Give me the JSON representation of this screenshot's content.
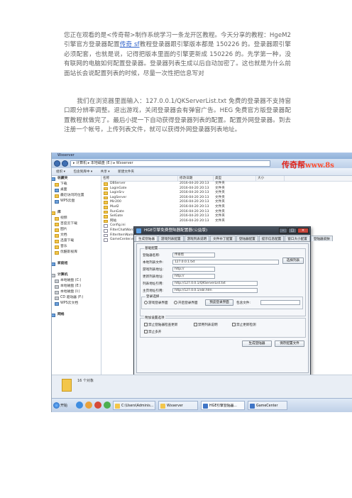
{
  "article": {
    "p1_a": "您正在观看的是<传奇帮>制作系统学习一条龙开区教程。今天分享的教程：HgeM2 引擎官方登录器配置",
    "p1_link": "传奇 sf",
    "p1_b": "教程登录器跟引擎版本都是 150226 的。登录器跟引擎必须配套，也就是说，记得把版本里面的引擎更新成 150226 的。先学第一种，没有联网的电脑如何配置登录器。登录器列表生成以后自动加密了。这也就是为什么前面站长会说配置列表的时候，尽量一次性把信息写对",
    "p2": "我们在浏览器里面输入：127.0.0.1/QKServerList.txt 免费的登录器不支持窗口跟分辨率调整。退出游戏，关闭登录器会有弹窗广告。HEG 免费官方版登录器配置教程就做完了。最后小提一下自动获得登录器列表的配置。配置外网登录器。到去注册一个帐号，上传列表文件，就可以获得外网登录器列表地址。"
  },
  "explorer": {
    "title": "Wxserver",
    "address": "▸ 计算机 ▸ 本地磁盘 (E:) ▸ Wxserver",
    "brand": "传奇帮",
    "brand_url": "www.8s",
    "cmdbar": [
      "组织 ▾",
      "包含到库中 ▾",
      "共享 ▾",
      "新建文件夹"
    ],
    "columns": [
      "名称",
      "修改日期",
      "类型",
      "大小"
    ],
    "nav": [
      {
        "label": "收藏夹",
        "head": true,
        "icon": "star"
      },
      {
        "label": "下载",
        "icon": "folder"
      },
      {
        "label": "桌面",
        "icon": "blue"
      },
      {
        "label": "最近访问的位置",
        "icon": "folder"
      },
      {
        "label": "WPS云盘",
        "icon": "blue"
      },
      {
        "label": "",
        "icon": ""
      },
      {
        "label": "库",
        "head": true,
        "icon": "folder"
      },
      {
        "label": "视频",
        "icon": "folder"
      },
      {
        "label": "百度云下载",
        "icon": "folder"
      },
      {
        "label": "图片",
        "icon": "folder"
      },
      {
        "label": "文档",
        "icon": "folder"
      },
      {
        "label": "迅雷下载",
        "icon": "folder"
      },
      {
        "label": "音乐",
        "icon": "folder"
      },
      {
        "label": "优酷影视库",
        "icon": "folder"
      },
      {
        "label": "",
        "icon": ""
      },
      {
        "label": "家庭组",
        "head": true,
        "icon": "blue"
      },
      {
        "label": "",
        "icon": ""
      },
      {
        "label": "计算机",
        "head": true,
        "icon": "gray"
      },
      {
        "label": "本地磁盘 (C:)",
        "icon": "gray"
      },
      {
        "label": "本地磁盘 (E:)",
        "icon": "gray"
      },
      {
        "label": "本地磁盘 (I:)",
        "icon": "gray"
      },
      {
        "label": "CD 驱动器 (F:)",
        "icon": "gray"
      },
      {
        "label": "WPS云文档",
        "icon": "blue"
      },
      {
        "label": "",
        "icon": ""
      },
      {
        "label": "网络",
        "head": true,
        "icon": "blue"
      }
    ],
    "files": [
      {
        "name": "DBServer",
        "date": "2016-04-20 20:13",
        "type": "文件夹",
        "doc": false
      },
      {
        "name": "LoginGate",
        "date": "2016-04-20 20:13",
        "type": "文件夹",
        "doc": false
      },
      {
        "name": "LoginSrv",
        "date": "2016-04-20 20:13",
        "type": "文件夹",
        "doc": false
      },
      {
        "name": "LogServer",
        "date": "2016-04-20 20:13",
        "type": "文件夹",
        "doc": false
      },
      {
        "name": "Mir200",
        "date": "2016-04-20 20:13",
        "type": "文件夹",
        "doc": false
      },
      {
        "name": "Mud2",
        "date": "2016-04-20 20:13",
        "type": "文件夹",
        "doc": false
      },
      {
        "name": "RunGate",
        "date": "2016-04-20 20:13",
        "type": "文件夹",
        "doc": false
      },
      {
        "name": "SelGate",
        "date": "2016-04-20 20:13",
        "type": "文件夹",
        "doc": false
      },
      {
        "name": "网站",
        "date": "2016-04-20 20:13",
        "type": "文件夹",
        "doc": false
      },
      {
        "name": "Config.ini",
        "date": "",
        "type": "",
        "doc": true
      },
      {
        "name": "FilterChatWords.txt",
        "date": "",
        "type": "",
        "doc": true
      },
      {
        "name": "FilterItemNames.txt",
        "date": "",
        "type": "",
        "doc": true
      },
      {
        "name": "GameCenter.exe",
        "date": "",
        "type": "",
        "doc": true
      }
    ],
    "status": "16 个对象"
  },
  "dialog": {
    "title": "HGE引擎免费登陆器配置器(公益版)",
    "tabs": [
      "生成登陆器",
      "游戏列表配置",
      "游戏列表说明",
      "文件补丁配置",
      "登陆器配置",
      "提示信息配置",
      "窗口大小配置",
      "登陆器皮肤"
    ],
    "group_main": "基础配置",
    "fields": [
      {
        "label": "登陆器名称:",
        "value": "传奇帮"
      },
      {
        "label": "本地列表文件:",
        "value": "127.0.0.1.txt"
      },
      {
        "label": "游戏列表地址:",
        "value": "http://"
      },
      {
        "label": "更新列表地址:",
        "value": "http://"
      },
      {
        "label": "列表地址引用:",
        "value": "http://127.0.0.1/QKServerList.txt"
      },
      {
        "label": "主页地址引用:",
        "value": "http://127.0.0.1/xbl.htm"
      }
    ],
    "browse_label": "选择列表",
    "group_window": "登录选择",
    "radio1": "游戏登录界面",
    "radio2": "开启登录界面",
    "check_btn": "预览登录界面",
    "pack_label": "包含文件:",
    "group_opts": "附加设置选项",
    "checks": [
      "禁止登陆器检查更新",
      "禁用列表说明",
      "禁止更新检测"
    ],
    "check4": "禁止多开",
    "btn_generate": "生成登陆器",
    "btn_save": "保存配置文件"
  },
  "taskbar": {
    "start": "开始",
    "items": [
      "C:\\Users\\Adminis...",
      "Wxserver",
      "HGE引擎登陆器...",
      "GameCenter"
    ]
  }
}
